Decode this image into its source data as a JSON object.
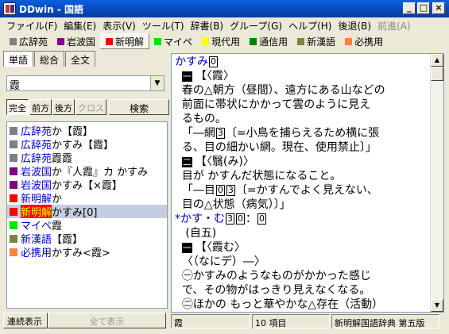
{
  "window": {
    "title": "DDwin - 国語",
    "minimize": "_",
    "maximize": "□",
    "close": "×"
  },
  "menu": [
    {
      "label": "ファイル(F)",
      "disabled": false
    },
    {
      "label": "編集(E)",
      "disabled": false
    },
    {
      "label": "表示(V)",
      "disabled": false
    },
    {
      "label": "ツール(T)",
      "disabled": false
    },
    {
      "label": "辞書(B)",
      "disabled": false
    },
    {
      "label": "グループ(G)",
      "disabled": false
    },
    {
      "label": "ヘルプ(H)",
      "disabled": false
    },
    {
      "label": "後退(B)",
      "disabled": false
    },
    {
      "label": "前進(A)",
      "disabled": true
    }
  ],
  "dictionaries": [
    {
      "label": "広辞苑",
      "color": "#808080",
      "active": false
    },
    {
      "label": "岩波国",
      "color": "#800080",
      "active": false
    },
    {
      "label": "新明解",
      "color": "#ff0000",
      "active": true
    },
    {
      "label": "マイペ",
      "color": "#00e000",
      "active": false
    },
    {
      "label": "現代用",
      "color": "#ffff00",
      "active": false
    },
    {
      "label": "通信用",
      "color": "#008000",
      "active": false
    },
    {
      "label": "新漢語",
      "color": "#808040",
      "active": false
    },
    {
      "label": "必携用",
      "color": "#ff8040",
      "active": false
    }
  ],
  "left": {
    "tabs": [
      {
        "label": "単語",
        "active": true
      },
      {
        "label": "総合",
        "active": false
      },
      {
        "label": "全文",
        "active": false
      }
    ],
    "search_value": "霞",
    "modes": [
      {
        "label": "完全",
        "pressed": true,
        "disabled": false
      },
      {
        "label": "前方",
        "pressed": false,
        "disabled": false
      },
      {
        "label": "後方",
        "pressed": false,
        "disabled": false
      },
      {
        "label": "クロス",
        "pressed": false,
        "disabled": true
      }
    ],
    "search_button": "検索",
    "results": [
      {
        "dict": "広辞苑",
        "text": "か【霞】",
        "color": "#808080",
        "selected": false
      },
      {
        "dict": "広辞苑",
        "text": "かすみ【霞】",
        "color": "#808080",
        "selected": false
      },
      {
        "dict": "広辞苑",
        "text": "霞霞",
        "color": "#808080",
        "selected": false
      },
      {
        "dict": "岩波国",
        "text": "か『人霞』カ かすみ",
        "color": "#800080",
        "selected": false
      },
      {
        "dict": "岩波国",
        "text": "かすみ【×霞】",
        "color": "#800080",
        "selected": false
      },
      {
        "dict": "新明解",
        "text": "か",
        "color": "#ff0000",
        "selected": false
      },
      {
        "dict": "新明解",
        "text": "かすみ[0]",
        "color": "#ff0000",
        "selected": true
      },
      {
        "dict": "マイペ",
        "text": " 霞",
        "color": "#00e000",
        "selected": false
      },
      {
        "dict": "新漢語",
        "text": "【霞】",
        "color": "#808040",
        "selected": false
      },
      {
        "dict": "必携用",
        "text": "かすみ<霞>",
        "color": "#ff8040",
        "selected": false
      }
    ],
    "continuous_button": "連続表示",
    "show_all_button": "全て表示"
  },
  "entry": {
    "headword": "かすみ",
    "accent": "0"
  },
  "status": {
    "query": "霞",
    "count": "10 項目",
    "dictionary": "新明解国語辞典  第五版"
  }
}
